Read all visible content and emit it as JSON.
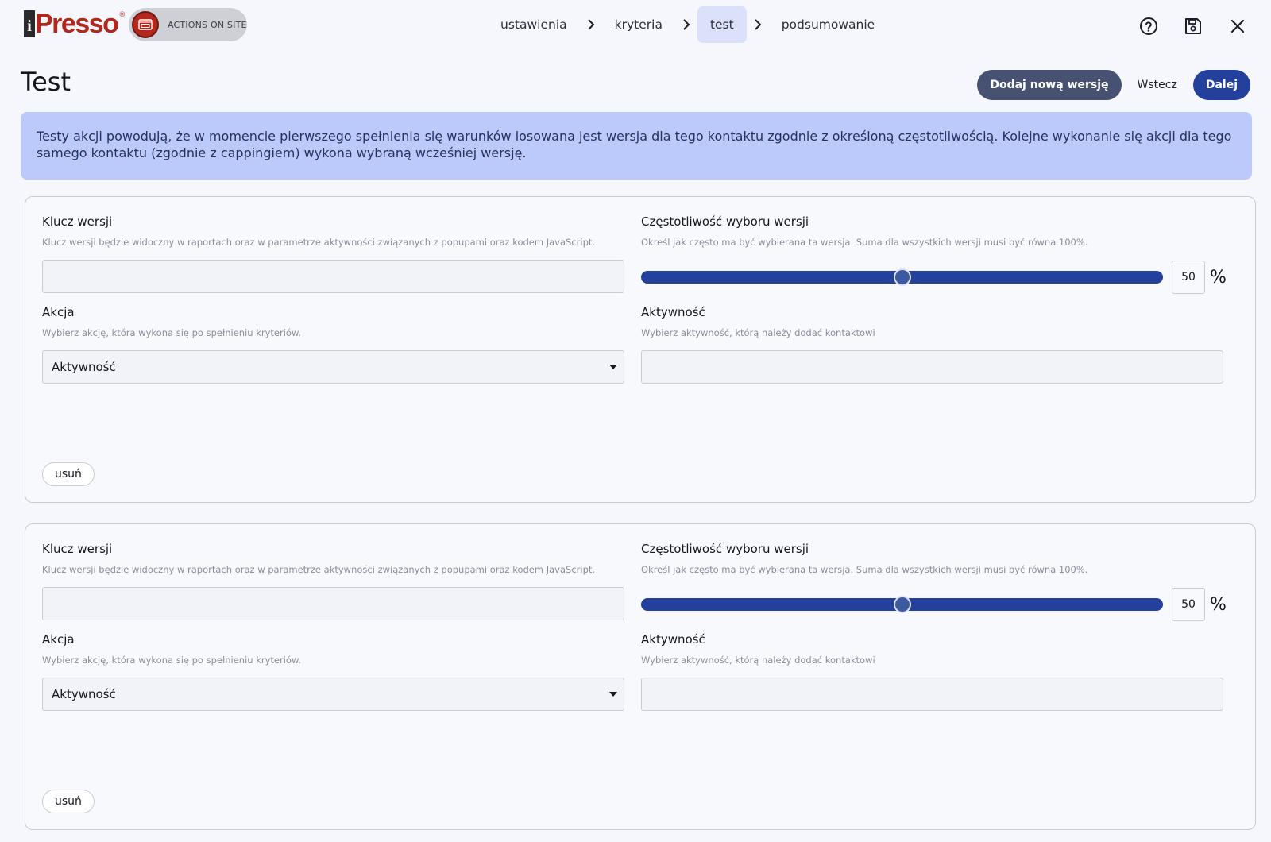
{
  "app": {
    "logo_text": "iPresso",
    "module_label": "ACTIONS ON SITE"
  },
  "breadcrumb": {
    "steps": [
      {
        "label": "ustawienia"
      },
      {
        "label": "kryteria"
      },
      {
        "label": "test",
        "active": true
      },
      {
        "label": "podsumowanie"
      }
    ]
  },
  "toolbar_icons": [
    "help-icon",
    "save-icon",
    "close-icon"
  ],
  "header": {
    "title": "Test",
    "add_version_label": "Dodaj nową wersję",
    "back_label": "Wstecz",
    "next_label": "Dalej"
  },
  "info_text": "Testy akcji powodują, że w momencie pierwszego spełnienia się warunków losowana jest wersja dla tego kontaktu zgodnie z określoną częstotliwością. Kolejne wykonanie się akcji dla tego samego kontaktu (zgodnie z cappingiem) wykona wybraną wcześniej wersję.",
  "versions": [
    {
      "key_label": "Klucz wersji",
      "key_help": "Klucz wersji będzie widoczny w raportach oraz w parametrze aktywności związanych z popupami oraz kodem JavaScript.",
      "key_value": "",
      "freq_label": "Częstotliwość wyboru wersji",
      "freq_help": "Określ jak często ma być wybierana ta wersja. Suma dla wszystkich wersji musi być równa 100%.",
      "freq_value": "50",
      "freq_unit": "%",
      "action_label": "Akcja",
      "action_help": "Wybierz akcję, która wykona się po spełnieniu kryteriów.",
      "action_value": "Aktywność",
      "activity_label": "Aktywność",
      "activity_help": "Wybierz aktywność, którą należy dodać kontaktowi",
      "activity_value": "",
      "remove_label": "usuń"
    },
    {
      "key_label": "Klucz wersji",
      "key_help": "Klucz wersji będzie widoczny w raportach oraz w parametrze aktywności związanych z popupami oraz kodem JavaScript.",
      "key_value": "",
      "freq_label": "Częstotliwość wyboru wersji",
      "freq_help": "Określ jak często ma być wybierana ta wersja. Suma dla wszystkich wersji musi być równa 100%.",
      "freq_value": "50",
      "freq_unit": "%",
      "action_label": "Akcja",
      "action_help": "Wybierz akcję, która wykona się po spełnieniu kryteriów.",
      "action_value": "Aktywność",
      "activity_label": "Aktywność",
      "activity_help": "Wybierz aktywność, którą należy dodać kontaktowi",
      "activity_value": "",
      "remove_label": "usuń"
    }
  ],
  "colors": {
    "brand_red": "#b3271d",
    "primary": "#23419c",
    "info_bg": "#bccafb",
    "step_active_bg": "#dbe0fb"
  }
}
